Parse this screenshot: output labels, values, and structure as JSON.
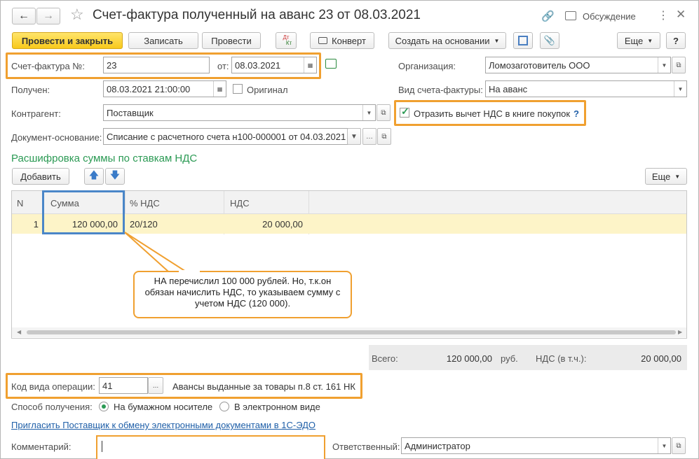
{
  "window": {
    "title": "Счет-фактура полученный на аванс 23 от 08.03.2021",
    "discussion": "Обсуждение"
  },
  "toolbar": {
    "post_close": "Провести и закрыть",
    "save": "Записать",
    "post": "Провести",
    "dtkt_top": "Дт",
    "dtkt_bottom": "Кт",
    "envelope": "Конверт",
    "create_based": "Создать на основании",
    "more": "Еще",
    "help": "?"
  },
  "form": {
    "invoice_no_label": "Счет-фактура №:",
    "invoice_no": "23",
    "from_label": "от:",
    "invoice_date": "08.03.2021",
    "org_label": "Организация:",
    "org": "Ломозаготовитель ООО",
    "received_label": "Получен:",
    "received": "08.03.2021 21:00:00",
    "original_label": "Оригинал",
    "invoice_type_label": "Вид счета-фактуры:",
    "invoice_type": "На аванс",
    "counterparty_label": "Контрагент:",
    "counterparty": "Поставщик",
    "reflect_label": "Отразить вычет НДС в книге покупок",
    "reflect_help": "?",
    "base_doc_label": "Документ-основание:",
    "base_doc": "Списание с расчетного счета н100-000001 от 04.03.2021"
  },
  "vat_section": {
    "title": "Расшифровка суммы по ставкам НДС",
    "add": "Добавить",
    "more": "Еще",
    "columns": [
      "N",
      "Сумма",
      "% НДС",
      "НДС"
    ],
    "rows": [
      {
        "n": "1",
        "sum": "120 000,00",
        "rate": "20/120",
        "vat": "20 000,00"
      }
    ]
  },
  "callout": {
    "text": "НА перечислил 100 000 рублей. Но, т.к.он обязан начислить НДС, то указываем сумму с учетом НДС (120 000)."
  },
  "totals": {
    "total_label": "Всего:",
    "total": "120 000,00",
    "currency": "руб.",
    "vat_label": "НДС (в т.ч.):",
    "vat": "20 000,00"
  },
  "operation": {
    "label": "Код вида операции:",
    "code": "41",
    "btn": "...",
    "desc": "Авансы выданные за товары п.8 ст. 161 НК"
  },
  "receive": {
    "label": "Способ получения:",
    "paper": "На бумажном носителе",
    "electronic": "В электронном виде"
  },
  "invite_link": "Пригласить Поставщик к обмену электронными документами в 1С-ЭДО",
  "comment": {
    "label": "Комментарий:",
    "value": ""
  },
  "responsible": {
    "label": "Ответственный:",
    "value": "Администратор"
  },
  "colors": {
    "accent_orange": "#f0a030",
    "accent_blue": "#4a86c8",
    "primary_yellow": "#f8c91b",
    "section_green": "#2b9a54",
    "link_blue": "#1f5fa8"
  }
}
